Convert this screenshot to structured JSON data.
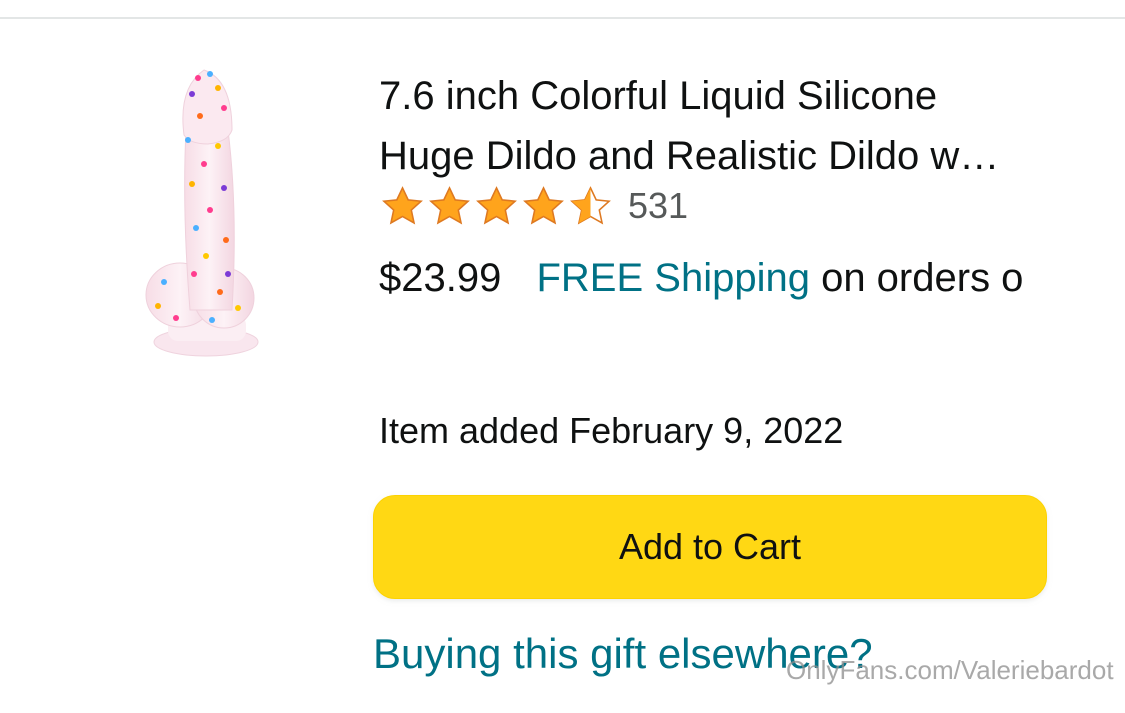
{
  "product": {
    "title_line1": "7.6 inch Colorful Liquid Silicone",
    "title_line2": "Huge Dildo and Realistic Dildo w…",
    "rating": {
      "stars": 4.5,
      "count": "531"
    },
    "price": "$23.99",
    "shipping": {
      "free_label": "FREE Shipping",
      "rest": "on orders o"
    },
    "item_added": "Item added February 9, 2022"
  },
  "actions": {
    "add_to_cart_label": "Add to Cart",
    "gift_link_label": "Buying this gift elsewhere?"
  },
  "watermark": "OnlyFans.com/Valeriebardot",
  "colors": {
    "button_yellow": "#ffd814",
    "link_teal": "#007185",
    "star_orange": "#ffa41c",
    "text_dark": "#0f1111"
  }
}
